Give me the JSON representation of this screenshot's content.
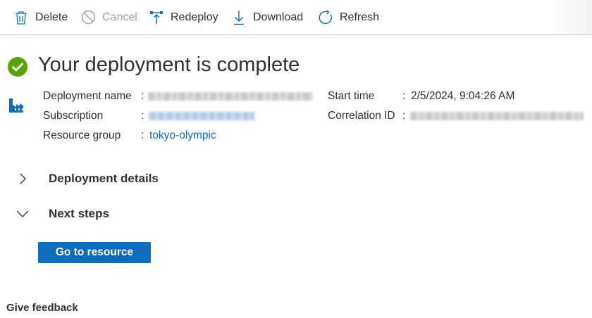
{
  "toolbar": {
    "delete_label": "Delete",
    "cancel_label": "Cancel",
    "redeploy_label": "Redeploy",
    "download_label": "Download",
    "refresh_label": "Refresh"
  },
  "header": {
    "title": "Your deployment is complete",
    "status_color": "#57a300"
  },
  "essentials": {
    "deployment_name_label": "Deployment name",
    "subscription_label": "Subscription",
    "resource_group_label": "Resource group",
    "resource_group_value": "tokyo-olympic",
    "start_time_label": "Start time",
    "start_time_value": "2/5/2024, 9:04:26 AM",
    "correlation_id_label": "Correlation ID",
    "separator": ":"
  },
  "sections": {
    "deployment_details": "Deployment details",
    "next_steps": "Next steps"
  },
  "actions": {
    "go_to_resource": "Go to resource"
  },
  "footer": {
    "give_feedback": "Give feedback"
  },
  "colors": {
    "accent": "#0f6cbd",
    "link": "#0f6cbd",
    "text": "#323130",
    "disabled": "#a19f9d"
  }
}
